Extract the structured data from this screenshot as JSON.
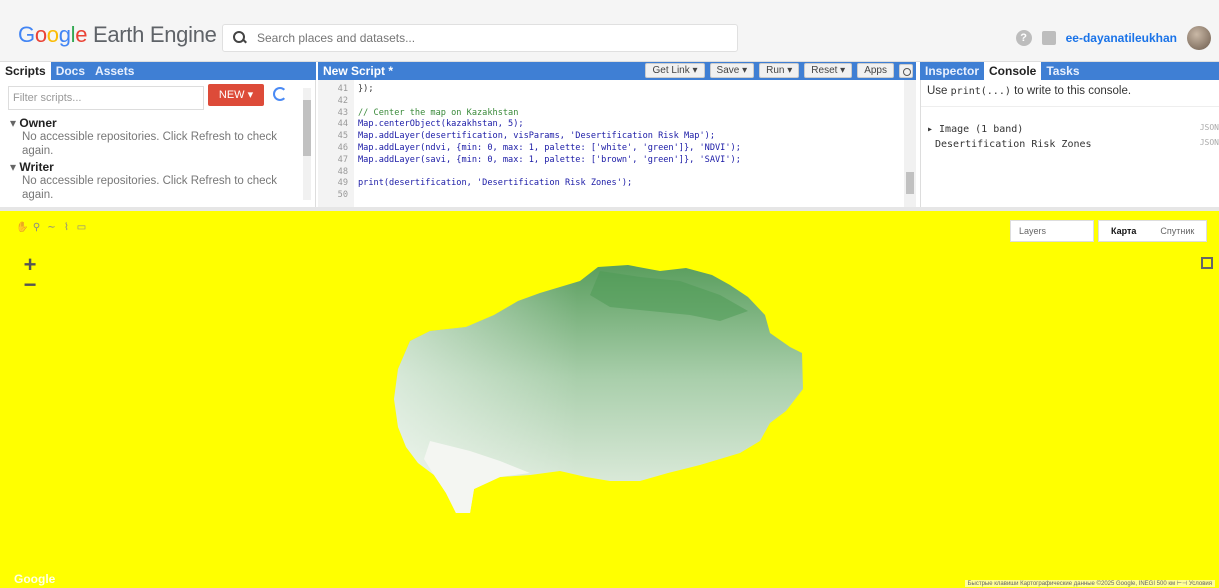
{
  "header": {
    "logo_google": [
      "G",
      "o",
      "o",
      "g",
      "l",
      "e"
    ],
    "logo_product": "Earth Engine",
    "search_placeholder": "Search places and datasets...",
    "user": "ee-dayanatileukhan"
  },
  "left_panel": {
    "tabs": [
      "Scripts",
      "Docs",
      "Assets"
    ],
    "filter_placeholder": "Filter scripts...",
    "new_label": "NEW ▾",
    "sections": [
      {
        "title": "Owner",
        "message": "No accessible repositories. Click Refresh to check again."
      },
      {
        "title": "Writer",
        "message": "No accessible repositories. Click Refresh to check again."
      }
    ]
  },
  "editor": {
    "title": "New Script *",
    "toolbar": [
      "Get Link ▾",
      "Save ▾",
      "Run ▾",
      "Reset ▾",
      "Apps"
    ],
    "lines": [
      {
        "num": "41",
        "text": "});"
      },
      {
        "num": "42",
        "text": ""
      },
      {
        "num": "43",
        "text": "// Center the map on Kazakhstan"
      },
      {
        "num": "44",
        "text": "Map.centerObject(kazakhstan, 5);"
      },
      {
        "num": "45",
        "text": "Map.addLayer(desertification, visParams, 'Desertification Risk Map');"
      },
      {
        "num": "46",
        "text": "Map.addLayer(ndvi, {min: 0, max: 1, palette: ['white', 'green']}, 'NDVI');"
      },
      {
        "num": "47",
        "text": "Map.addLayer(savi, {min: 0, max: 1, palette: ['brown', 'green']}, 'SAVI');"
      },
      {
        "num": "48",
        "text": ""
      },
      {
        "num": "49",
        "text": "print(desertification, 'Desertification Risk Zones');"
      },
      {
        "num": "50",
        "text": ""
      }
    ]
  },
  "right_panel": {
    "tabs": [
      "Inspector",
      "Console",
      "Tasks"
    ],
    "hint_prefix": "Use",
    "hint_code": "print(...)",
    "hint_suffix": "to write to this console.",
    "output_line1": "▸ Image (1 band)",
    "output_line2": "Desertification Risk Zones",
    "size_label": "JSON"
  },
  "map": {
    "layers_label": "Layers",
    "map_type_map": "Карта",
    "map_type_satellite": "Спутник",
    "watermark": "Google",
    "attribution": "Быстрые клавиши   Картографические данные ©2025 Google, INEGI   500 км ⊢⊣   Условия",
    "background_color": "#ffff00"
  }
}
